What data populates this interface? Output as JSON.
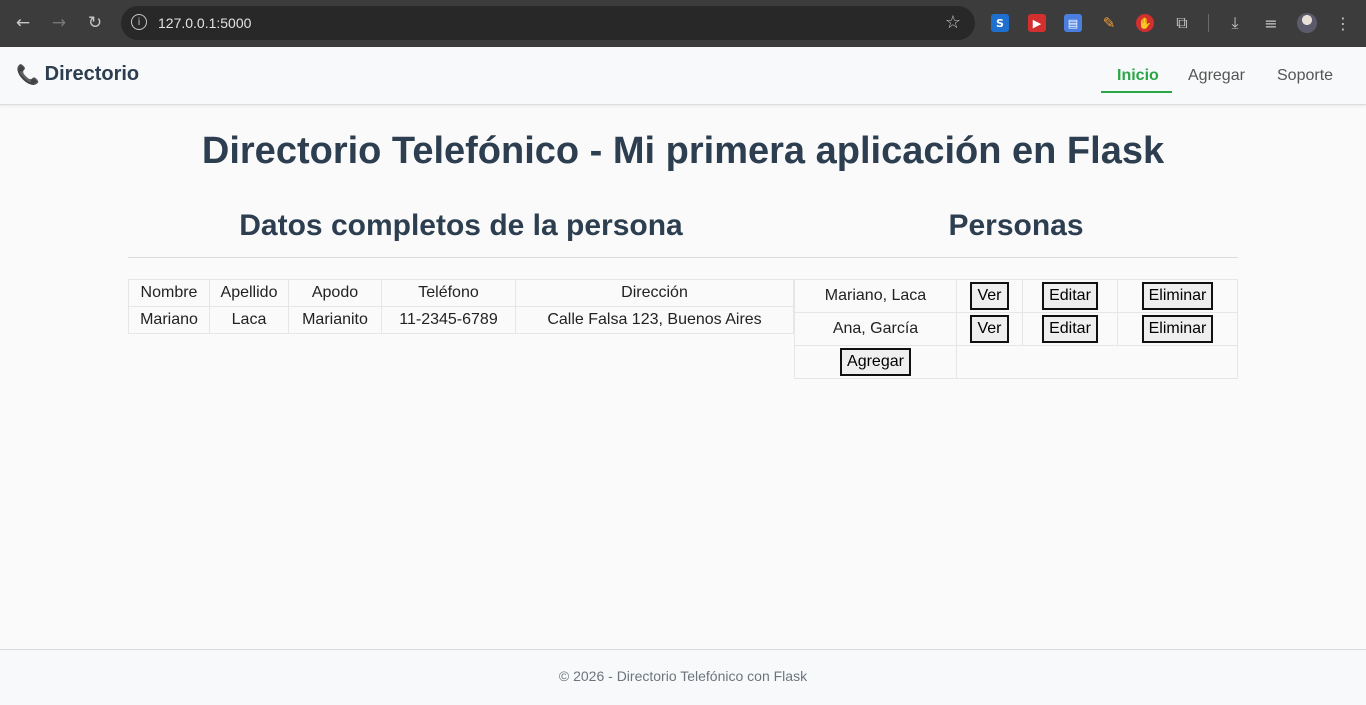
{
  "browser": {
    "url": "127.0.0.1:5000",
    "icons": [
      "back-icon",
      "forward-icon",
      "reload-icon",
      "site-info-icon",
      "bookmark-star-icon",
      "download-icon",
      "media-control-icon",
      "profile-avatar",
      "more-menu-icon"
    ],
    "extensions": [
      "s-extension-icon",
      "video-extension-icon",
      "docs-extension-icon",
      "pen-extension-icon",
      "hand-extension-icon",
      "puzzle-extensions-icon"
    ]
  },
  "navbar": {
    "brand_icon": "📞",
    "brand": "Directorio",
    "links": [
      {
        "label": "Inicio",
        "active": true
      },
      {
        "label": "Agregar",
        "active": false
      },
      {
        "label": "Soporte",
        "active": false
      }
    ],
    "active_color": "#28a745"
  },
  "main": {
    "title": "Directorio Telefónico - Mi primera aplicación en Flask",
    "details_heading": "Datos completos de la persona",
    "people_heading": "Personas"
  },
  "details": {
    "headers": [
      "Nombre",
      "Apellido",
      "Apodo",
      "Teléfono",
      "Dirección"
    ],
    "row": [
      "Mariano",
      "Laca",
      "Marianito",
      "11-2345-6789",
      "Calle Falsa 123, Buenos Aires"
    ]
  },
  "people": {
    "rows": [
      {
        "name": "Mariano, Laca",
        "view": "Ver",
        "edit": "Editar",
        "delete": "Eliminar"
      },
      {
        "name": "Ana, García",
        "view": "Ver",
        "edit": "Editar",
        "delete": "Eliminar"
      }
    ],
    "add_label": "Agregar"
  },
  "footer": {
    "text": "© 2026 - Directorio Telefónico con Flask"
  }
}
